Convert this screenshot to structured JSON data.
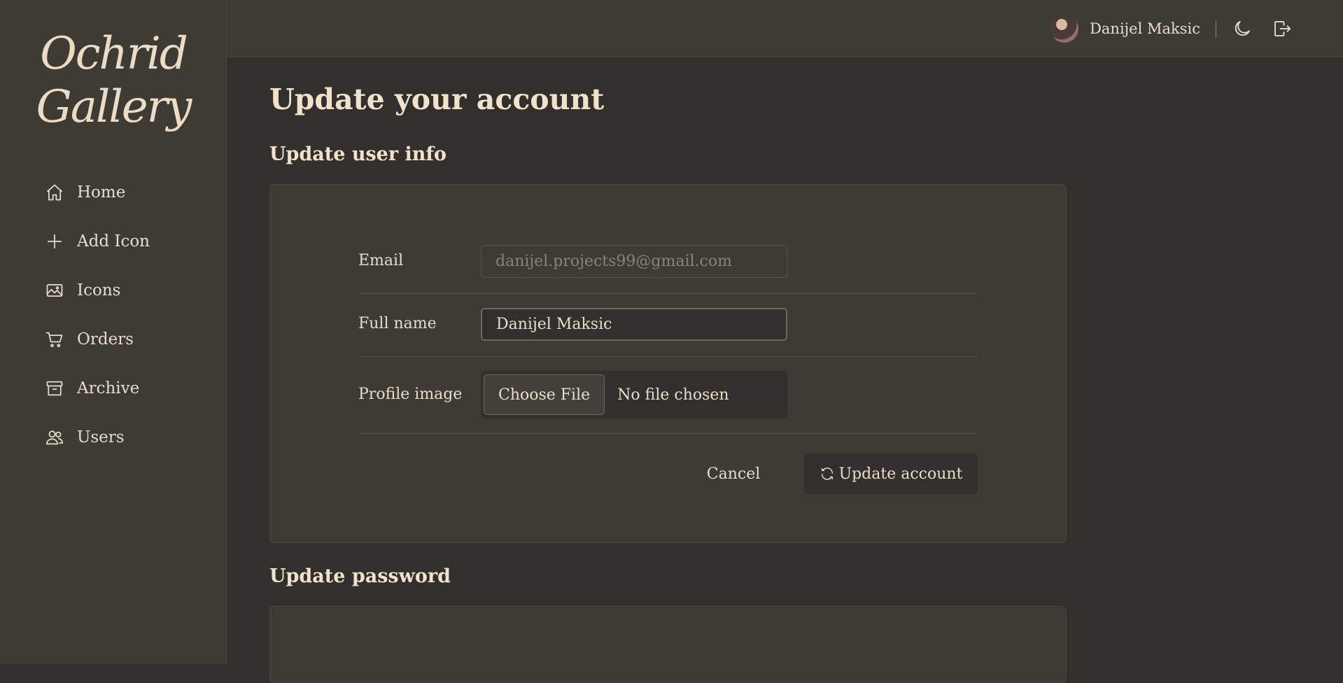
{
  "app": {
    "logo_line1": "Ochrid",
    "logo_line2": "Gallery"
  },
  "sidebar": {
    "items": [
      {
        "label": "Home",
        "icon": "home-icon"
      },
      {
        "label": "Add Icon",
        "icon": "plus-icon"
      },
      {
        "label": "Icons",
        "icon": "image-icon"
      },
      {
        "label": "Orders",
        "icon": "cart-icon"
      },
      {
        "label": "Archive",
        "icon": "archive-icon"
      },
      {
        "label": "Users",
        "icon": "users-icon"
      }
    ]
  },
  "header": {
    "user_name": "Danijel Maksic",
    "icons": [
      "avatar",
      "moon-icon",
      "logout-icon"
    ]
  },
  "page": {
    "title": "Update your account",
    "section_user_info": "Update user info",
    "section_password": "Update password"
  },
  "form": {
    "email_label": "Email",
    "email_value": "danijel.projects99@gmail.com",
    "fullname_label": "Full name",
    "fullname_value": "Danijel Maksic",
    "profile_label": "Profile image",
    "file_button": "Choose File",
    "file_status": "No file chosen",
    "cancel_label": "Cancel",
    "update_label": "Update account"
  },
  "colors": {
    "background": "#332f2c",
    "panel": "#3e3a34",
    "text": "#e8dccb"
  }
}
